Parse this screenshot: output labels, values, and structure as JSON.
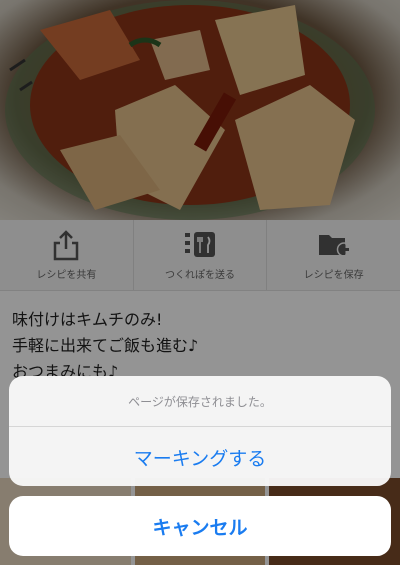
{
  "actions": [
    {
      "label": "レシピを共有",
      "icon": "share-icon"
    },
    {
      "label": "つくれぽを送る",
      "icon": "report-menu-icon"
    },
    {
      "label": "レシピを保存",
      "icon": "folder-add-icon"
    }
  ],
  "description": [
    "味付けはキムチのみ!",
    "手軽に出来てご飯も進む♪",
    "おつまみにも♪"
  ],
  "sheet": {
    "title": "ページが保存されました。",
    "marking_label": "マーキングする",
    "cancel_label": "キャンセル"
  },
  "colors": {
    "accent": "#1a7cf0",
    "overlay": "rgba(0,0,0,0.42)"
  }
}
